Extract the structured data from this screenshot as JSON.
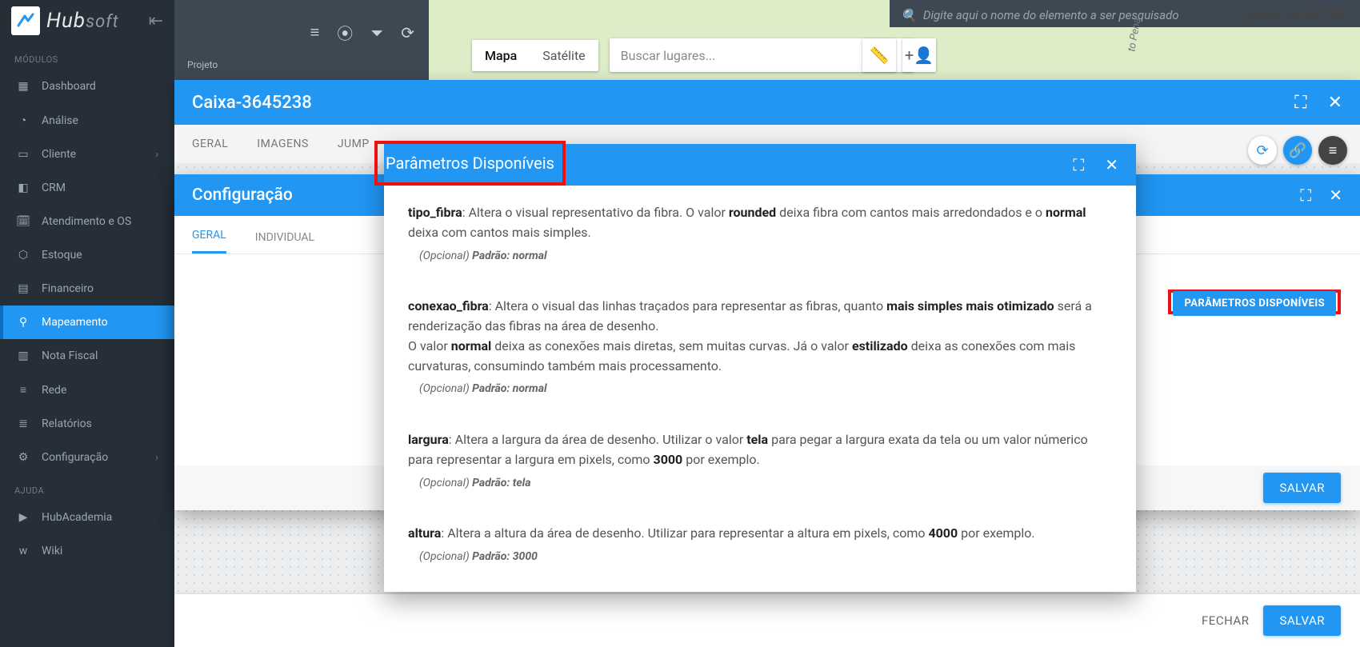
{
  "app": {
    "logo_main": "Hub",
    "logo_soft": "soft"
  },
  "top": {
    "project_label": "Projeto",
    "search_placeholder": "Digite aqui o nome do elemento a ser pesquisado",
    "title": "Caixa-3645238"
  },
  "map": {
    "map_label": "Mapa",
    "satellite_label": "Satélite",
    "search_placeholder": "Buscar lugares...",
    "road_label": "to Pena"
  },
  "sidebar": {
    "section_modulos": "MÓDULOS",
    "section_ajuda": "AJUDA",
    "items": [
      {
        "label": "Dashboard"
      },
      {
        "label": "Análise"
      },
      {
        "label": "Cliente"
      },
      {
        "label": "CRM"
      },
      {
        "label": "Atendimento e OS"
      },
      {
        "label": "Estoque"
      },
      {
        "label": "Financeiro"
      },
      {
        "label": "Mapeamento"
      },
      {
        "label": "Nota Fiscal"
      },
      {
        "label": "Rede"
      },
      {
        "label": "Relatórios"
      },
      {
        "label": "Configuração"
      }
    ],
    "help": [
      {
        "label": "HubAcademia"
      },
      {
        "label": "Wiki"
      }
    ]
  },
  "modal1": {
    "title": "Caixa-3645238",
    "tabs": [
      "GERAL",
      "IMAGENS",
      "JUMP"
    ],
    "footer_close": "FECHAR",
    "footer_save": "SALVAR"
  },
  "modal2": {
    "title": "Configuração",
    "tabs": [
      "GERAL",
      "INDIVIDUAL"
    ],
    "param_button": "PARÂMETROS DISPONÍVEIS",
    "footer_save": "SALVAR"
  },
  "modal3": {
    "title": "Parâmetros Disponíveis",
    "params": [
      {
        "name": "tipo_fibra",
        "desc_1": ": Altera o visual representativo da fibra. O valor ",
        "bold_1": "rounded",
        "desc_2": " deixa fibra com cantos mais arredondados e o ",
        "bold_2": "normal",
        "desc_3": " deixa com cantos mais simples.",
        "hint_opt": "(Opcional) ",
        "hint_def": "Padrão: normal"
      },
      {
        "name": "conexao_fibra",
        "desc_1": ": Altera o visual das linhas traçados para representar as fibras, quanto ",
        "bold_1": "mais simples mais otimizado",
        "desc_2": " será a renderização das fibras na área de desenho.",
        "line2_a": "O valor ",
        "line2_b1": "normal",
        "line2_c": " deixa as conexões mais diretas, sem muitas curvas. Já o valor ",
        "line2_b2": "estilizado",
        "line2_d": " deixa as conexões com mais curvaturas, consumindo também mais processamento.",
        "hint_opt": "(Opcional) ",
        "hint_def": "Padrão: normal"
      },
      {
        "name": "largura",
        "desc_1": ": Altera a largura da área de desenho. Utilizar o valor ",
        "bold_1": "tela",
        "desc_2": " para pegar a largura exata da tela ou um valor númerico para representar a largura em pixels, como ",
        "bold_2": "3000",
        "desc_3": " por exemplo.",
        "hint_opt": "(Opcional) ",
        "hint_def": "Padrão: tela"
      },
      {
        "name": "altura",
        "desc_1": ": Altera a altura da área de desenho. Utilizar para representar a altura em pixels, como ",
        "bold_1": "4000",
        "desc_2": " por exemplo.",
        "hint_opt": "(Opcional) ",
        "hint_def": "Padrão: 3000"
      }
    ]
  }
}
